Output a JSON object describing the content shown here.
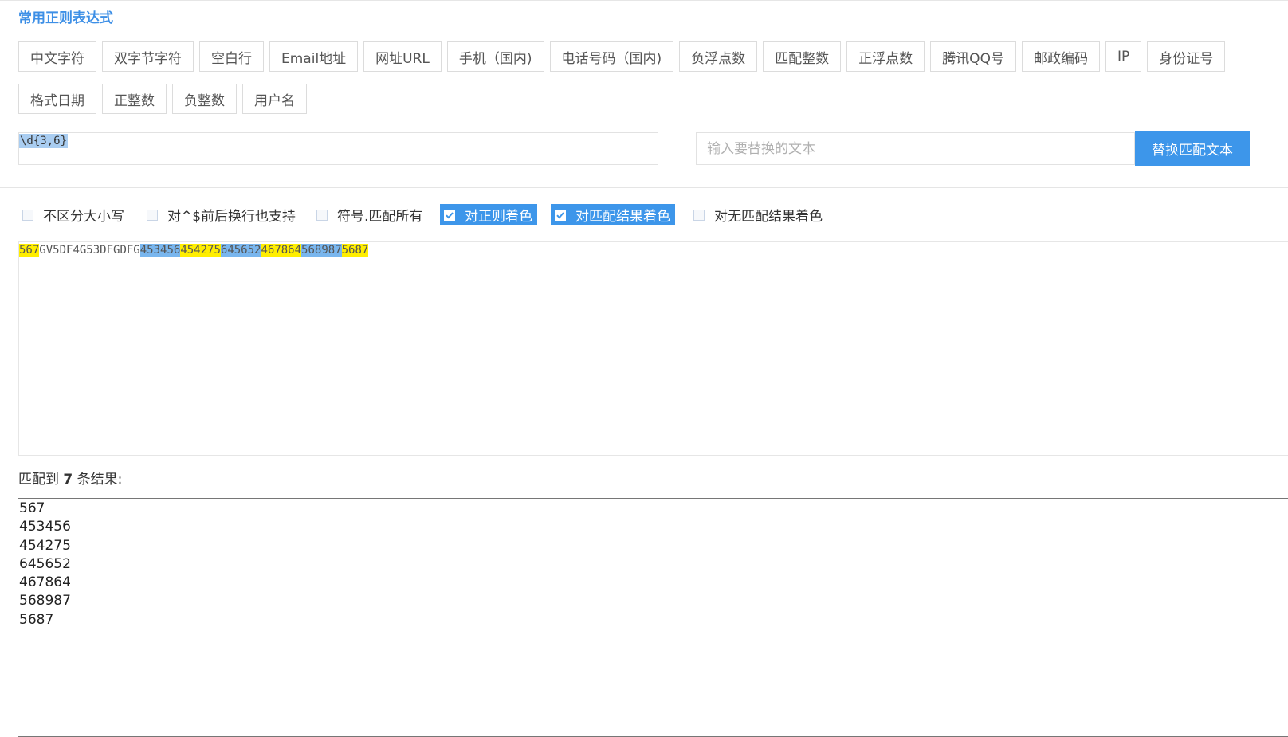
{
  "section_title": "常用正则表达式",
  "presets_row1": [
    "中文字符",
    "双字节字符",
    "空白行",
    "Email地址",
    "网址URL",
    "手机（国内)",
    "电话号码（国内)",
    "负浮点数",
    "匹配整数",
    "正浮点数",
    "腾讯QQ号",
    "邮政编码",
    "IP",
    "身份证号"
  ],
  "presets_row2": [
    "格式日期",
    "正整数",
    "负整数",
    "用户名"
  ],
  "regex": "\\d{3,6}",
  "replace": {
    "placeholder": "输入要替换的文本",
    "value": "",
    "button_label": "替换匹配文本"
  },
  "options": [
    {
      "label": "不区分大小写",
      "checked": false
    },
    {
      "label": "对^$前后换行也支持",
      "checked": false
    },
    {
      "label": "符号.匹配所有",
      "checked": false
    },
    {
      "label": "对正则着色",
      "checked": true
    },
    {
      "label": "对匹配结果着色",
      "checked": true
    },
    {
      "label": "对无匹配结果着色",
      "checked": false
    }
  ],
  "source_segments": [
    {
      "text": "567",
      "style": "yellow"
    },
    {
      "text": "GV5DF4G53DFGDFG",
      "style": "plain"
    },
    {
      "text": "453456",
      "style": "blue"
    },
    {
      "text": "454275",
      "style": "yellow"
    },
    {
      "text": "645652",
      "style": "blue"
    },
    {
      "text": "467864",
      "style": "yellow"
    },
    {
      "text": "568987",
      "style": "blue"
    },
    {
      "text": "5687",
      "style": "yellow"
    }
  ],
  "match_summary": {
    "prefix": "匹配到",
    "count": "7",
    "suffix": "条结果:"
  },
  "results": [
    "567",
    "453456",
    "454275",
    "645652",
    "467864",
    "568987",
    "5687"
  ],
  "colors": {
    "accent": "#3d96ea",
    "highlight_yellow": "#ffee00",
    "highlight_blue": "#79b6ee"
  }
}
